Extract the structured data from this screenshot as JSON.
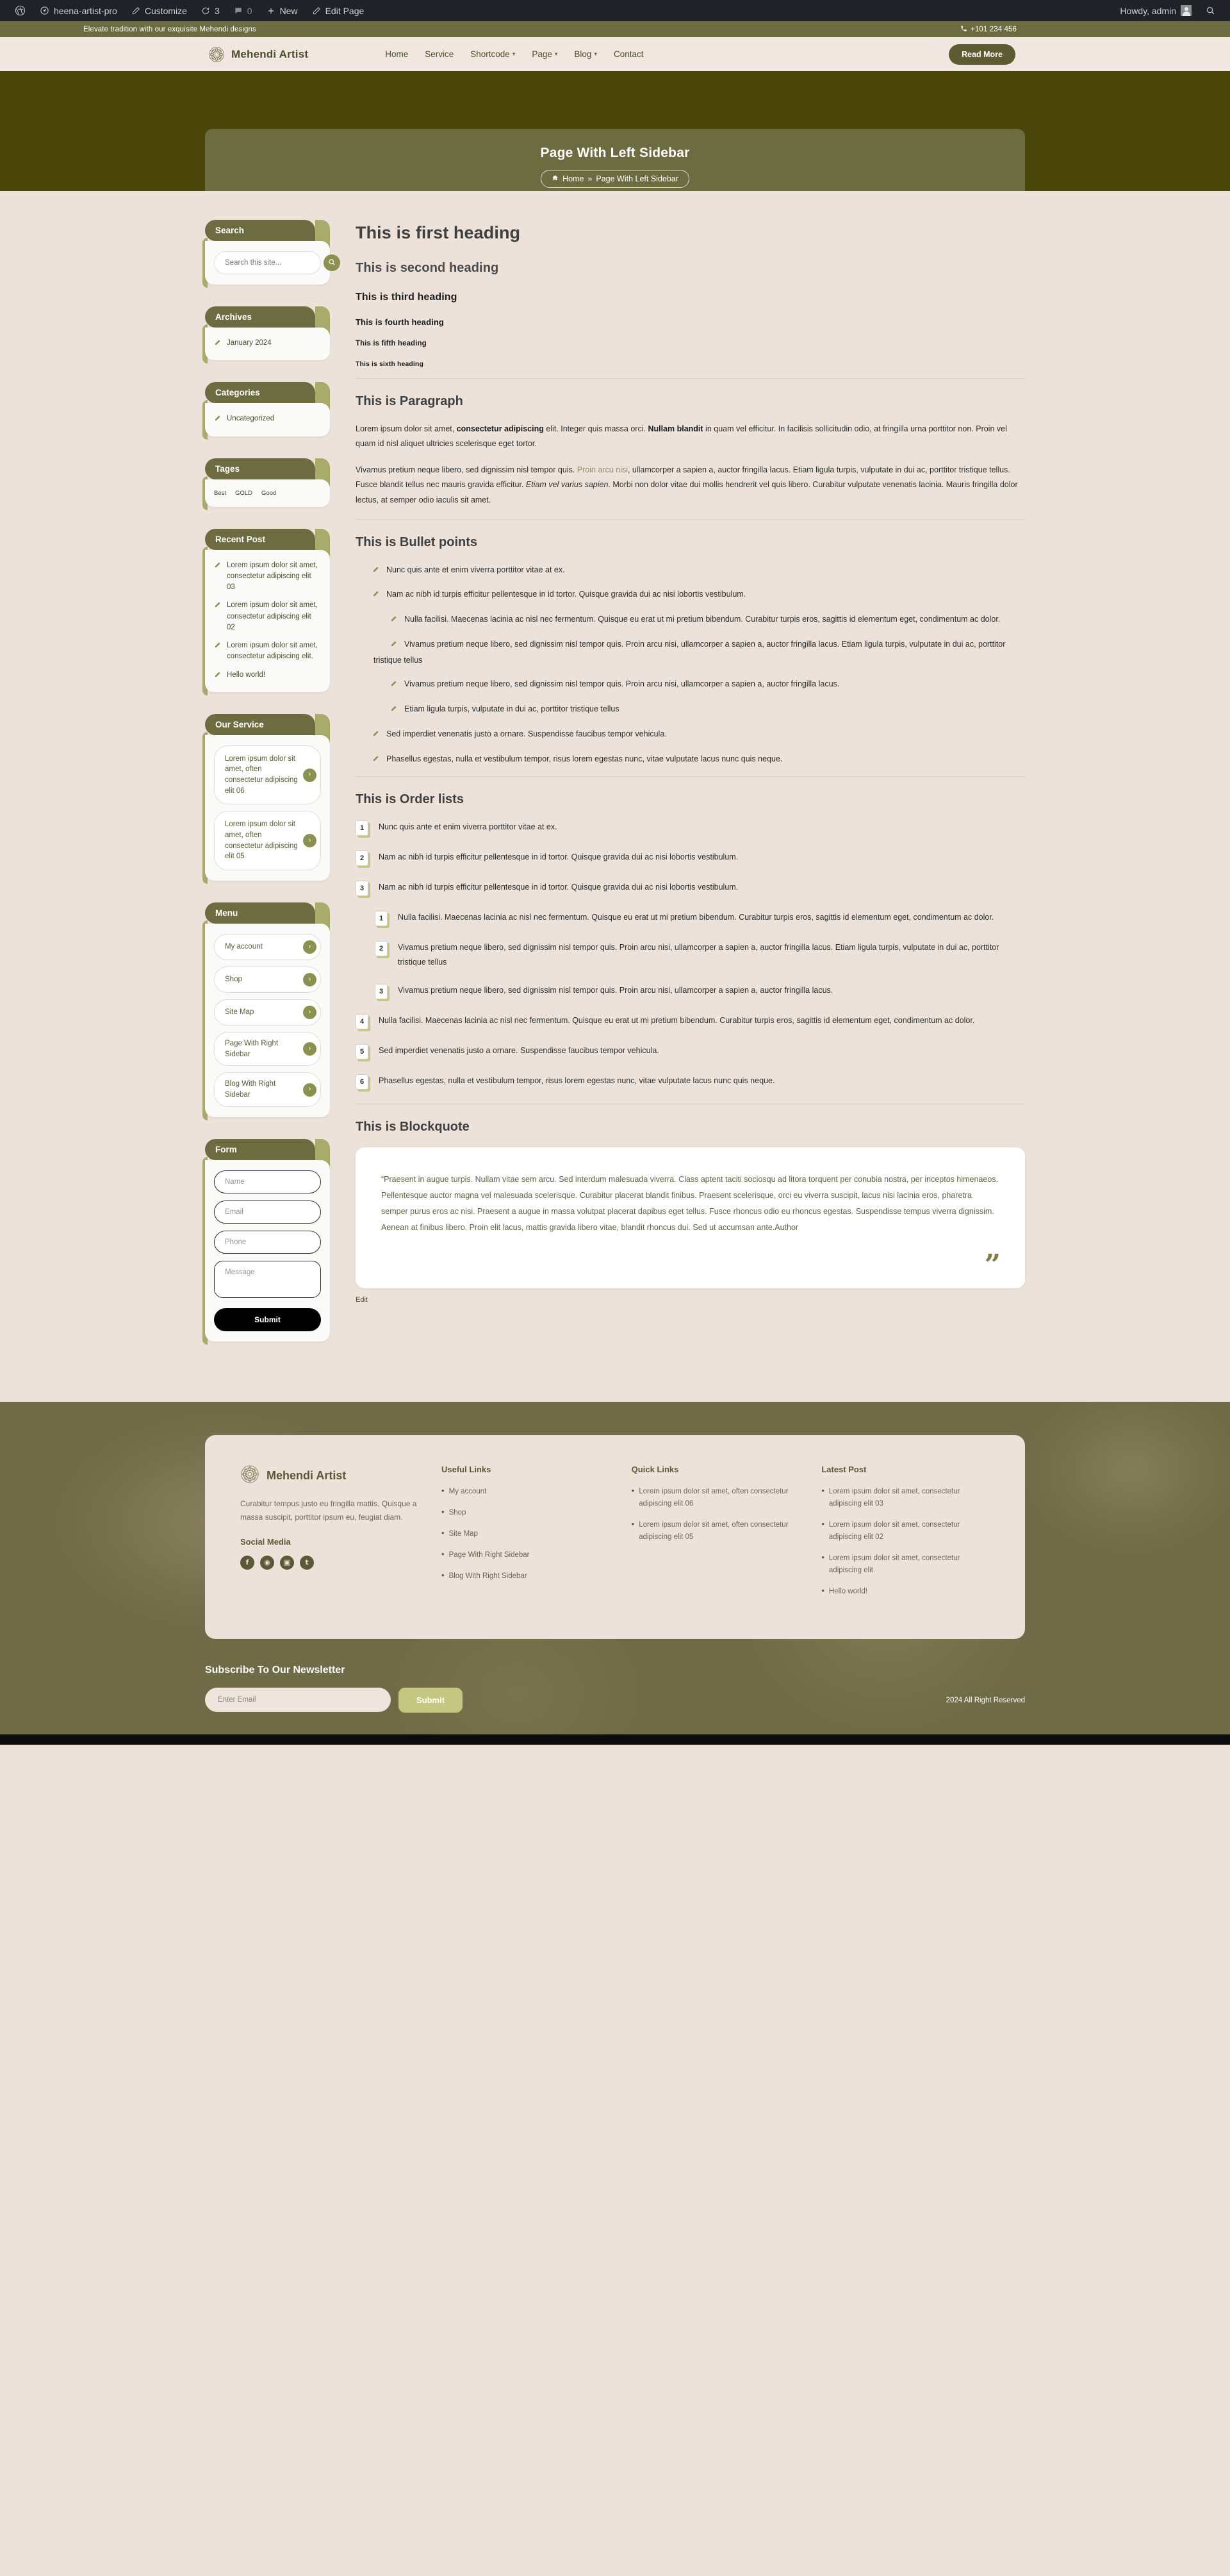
{
  "adminbar": {
    "site_name": "heena-artist-pro",
    "customize": "Customize",
    "updates_count": "3",
    "comments_count": "0",
    "new": "New",
    "edit_page": "Edit Page",
    "howdy": "Howdy, admin"
  },
  "topbar": {
    "tagline": "Elevate tradition with our exquisite Mehendi designs",
    "phone": "+101 234 456"
  },
  "header": {
    "brand": "Mehendi Artist",
    "nav": [
      {
        "label": "Home",
        "caret": false
      },
      {
        "label": "Service",
        "caret": false
      },
      {
        "label": "Shortcode",
        "caret": true
      },
      {
        "label": "Page",
        "caret": true
      },
      {
        "label": "Blog",
        "caret": true
      },
      {
        "label": "Contact",
        "caret": false
      }
    ],
    "cta": "Read More"
  },
  "banner": {
    "title": "Page With Left Sidebar",
    "crumb_home": "Home",
    "crumb_sep": "»",
    "crumb_current": "Page With Left Sidebar"
  },
  "sidebar": {
    "search": {
      "title": "Search",
      "placeholder": "Search this site...",
      "value": ""
    },
    "archives": {
      "title": "Archives",
      "items": [
        "January 2024"
      ]
    },
    "categories": {
      "title": "Categories",
      "items": [
        "Uncategorized"
      ]
    },
    "tags": {
      "title": "Tages",
      "items": [
        "Best",
        "GOLD",
        "Good"
      ]
    },
    "recent_post": {
      "title": "Recent Post",
      "items": [
        "Lorem ipsum dolor sit amet, consectetur adipiscing elit 03",
        "Lorem ipsum dolor sit amet, consectetur adipiscing elit 02",
        "Lorem ipsum dolor sit amet, consectetur adipiscing elit.",
        "Hello world!"
      ]
    },
    "our_service": {
      "title": "Our Service",
      "items": [
        "Lorem ipsum dolor sit amet, often consectetur adipiscing elit 06",
        "Lorem ipsum dolor sit amet, often consectetur adipiscing elit 05"
      ]
    },
    "menu": {
      "title": "Menu",
      "items": [
        "My account",
        "Shop",
        "Site Map",
        "Page With Right Sidebar",
        "Blog With Right Sidebar"
      ]
    },
    "form": {
      "title": "Form",
      "name_placeholder": "Name",
      "email_placeholder": "Email",
      "phone_placeholder": "Phone",
      "message_placeholder": "Message",
      "submit": "Submit"
    }
  },
  "main": {
    "headings": [
      "This is first heading",
      "This is second heading",
      "This is third heading",
      "This is fourth heading",
      "This is fifth heading",
      "This is sixth heading"
    ],
    "paragraph_section": {
      "title": "This is Paragraph",
      "p1_a": "Lorem ipsum dolor sit amet, ",
      "p1_b": "consectetur adipiscing",
      "p1_c": " elit. Integer quis massa orci. ",
      "p1_d": "Nullam blandit",
      "p1_e": " in quam vel efficitur. In facilisis sollicitudin odio, at fringilla urna porttitor non. Proin vel quam id nisl aliquet ultricies scelerisque eget tortor.",
      "p2_a": "Vivamus pretium neque libero, sed dignissim nisl tempor quis. ",
      "p2_link": "Proin arcu nisi",
      "p2_b": ", ullamcorper a sapien a, auctor fringilla lacus. Etiam ligula turpis, vulputate in dui ac, porttitor tristique tellus. Fusce blandit tellus nec mauris gravida efficitur. ",
      "p2_em": "Etiam vel varius sapien",
      "p2_c": ". Morbi non dolor vitae dui mollis hendrerit vel quis libero. Curabitur vulputate venenatis lacinia. Mauris fringilla dolor lectus, at semper odio iaculis sit amet."
    },
    "bullet_section": {
      "title": "This is Bullet points",
      "items": [
        {
          "text": "Nunc quis ante et enim viverra porttitor vitae at ex.",
          "nested": false
        },
        {
          "text": "Nam ac nibh id turpis efficitur pellentesque in id tortor. Quisque gravida dui ac nisi lobortis vestibulum.",
          "nested": false
        },
        {
          "text": "Nulla facilisi. Maecenas lacinia ac nisl nec fermentum. Quisque eu erat ut mi pretium bibendum. Curabitur turpis eros, sagittis id elementum eget, condimentum ac dolor.",
          "nested": true
        },
        {
          "text": "Vivamus pretium neque libero, sed dignissim nisl tempor quis. Proin arcu nisi, ullamcorper a sapien a, auctor fringilla lacus. Etiam ligula turpis, vulputate in dui ac, porttitor tristique tellus",
          "nested": true
        },
        {
          "text": "Vivamus pretium neque libero, sed dignissim nisl tempor quis. Proin arcu nisi, ullamcorper a sapien a, auctor fringilla lacus.",
          "nested": true
        },
        {
          "text": "Etiam ligula turpis, vulputate in dui ac, porttitor tristique tellus",
          "nested": true
        },
        {
          "text": "Sed imperdiet venenatis justo a ornare. Suspendisse faucibus tempor vehicula.",
          "nested": false
        },
        {
          "text": "Phasellus egestas, nulla et vestibulum tempor, risus lorem egestas nunc, vitae vulputate lacus nunc quis neque.",
          "nested": false
        }
      ]
    },
    "order_section": {
      "title": "This is Order lists",
      "items": [
        {
          "num": "1",
          "text": "Nunc quis ante et enim viverra porttitor vitae at ex.",
          "nested": false
        },
        {
          "num": "2",
          "text": "Nam ac nibh id turpis efficitur pellentesque in id tortor. Quisque gravida dui ac nisi lobortis vestibulum.",
          "nested": false
        },
        {
          "num": "3",
          "text": "Nam ac nibh id turpis efficitur pellentesque in id tortor. Quisque gravida dui ac nisi lobortis vestibulum.",
          "nested": false
        },
        {
          "num": "1",
          "text": "Nulla facilisi. Maecenas lacinia ac nisl nec fermentum. Quisque eu erat ut mi pretium bibendum. Curabitur turpis eros, sagittis id elementum eget, condimentum ac dolor.",
          "nested": true
        },
        {
          "num": "2",
          "text": "Vivamus pretium neque libero, sed dignissim nisl tempor quis. Proin arcu nisi, ullamcorper a sapien a, auctor fringilla lacus. Etiam ligula turpis, vulputate in dui ac, porttitor tristique tellus",
          "nested": true
        },
        {
          "num": "3",
          "text": "Vivamus pretium neque libero, sed dignissim nisl tempor quis. Proin arcu nisi, ullamcorper a sapien a, auctor fringilla lacus.",
          "nested": true
        },
        {
          "num": "4",
          "text": "Nulla facilisi. Maecenas lacinia ac nisl nec fermentum. Quisque eu erat ut mi pretium bibendum. Curabitur turpis eros, sagittis id elementum eget, condimentum ac dolor.",
          "nested": false
        },
        {
          "num": "5",
          "text": "Sed imperdiet venenatis justo a ornare. Suspendisse faucibus tempor vehicula.",
          "nested": false
        },
        {
          "num": "6",
          "text": "Phasellus egestas, nulla et vestibulum tempor, risus lorem egestas nunc, vitae vulputate lacus nunc quis neque.",
          "nested": false
        }
      ]
    },
    "blockquote_section": {
      "title": "This is Blockquote",
      "text": "“Praesent in augue turpis. Nullam vitae sem arcu. Sed interdum malesuada viverra. Class aptent taciti sociosqu ad litora torquent per conubia nostra, per inceptos himenaeos. Pellentesque auctor magna vel malesuada scelerisque. Curabitur placerat blandit finibus. Praesent scelerisque, orci eu viverra suscipit, lacus nisi lacinia eros, pharetra semper purus eros ac nisi. Praesent a augue in massa volutpat placerat dapibus eget tellus. Fusce rhoncus odio eu rhoncus egestas. Suspendisse tempus viverra dignissim. Aenean at finibus libero. Proin elit lacus, mattis gravida libero vitae, blandit rhoncus dui. Sed ut accumsan ante.Author",
      "quote_mark": "”"
    },
    "edit_link": "Edit"
  },
  "footer": {
    "brand": "Mehendi Artist",
    "description": "Curabitur tempus justo eu fringilla mattis. Quisque a massa suscipit, porttitor ipsum eu, feugiat diam.",
    "social_title": "Social Media",
    "social": [
      "f",
      "◉",
      "▣",
      "t"
    ],
    "useful_links": {
      "title": "Useful Links",
      "items": [
        "My account",
        "Shop",
        "Site Map",
        "Page With Right Sidebar",
        "Blog With Right Sidebar"
      ]
    },
    "quick_links": {
      "title": "Quick Links",
      "items": [
        "Lorem ipsum dolor sit amet, often consectetur adipiscing elit 06",
        "Lorem ipsum dolor sit amet, often consectetur adipiscing elit 05"
      ]
    },
    "latest_post": {
      "title": "Latest Post",
      "items": [
        "Lorem ipsum dolor sit amet, consectetur adipiscing elit 03",
        "Lorem ipsum dolor sit amet, consectetur adipiscing elit 02",
        "Lorem ipsum dolor sit amet, consectetur adipiscing elit.",
        "Hello world!"
      ]
    },
    "newsletter": {
      "title": "Subscribe To Our Newsletter",
      "placeholder": "Enter Email",
      "submit": "Submit"
    },
    "copyright": "2024 All Right Reserved"
  },
  "colors": {
    "olive": "#6d6b40",
    "dark_olive": "#4a4508",
    "accent": "#c3c77f",
    "bg": "#ece2da",
    "sage": "#8c9150"
  }
}
